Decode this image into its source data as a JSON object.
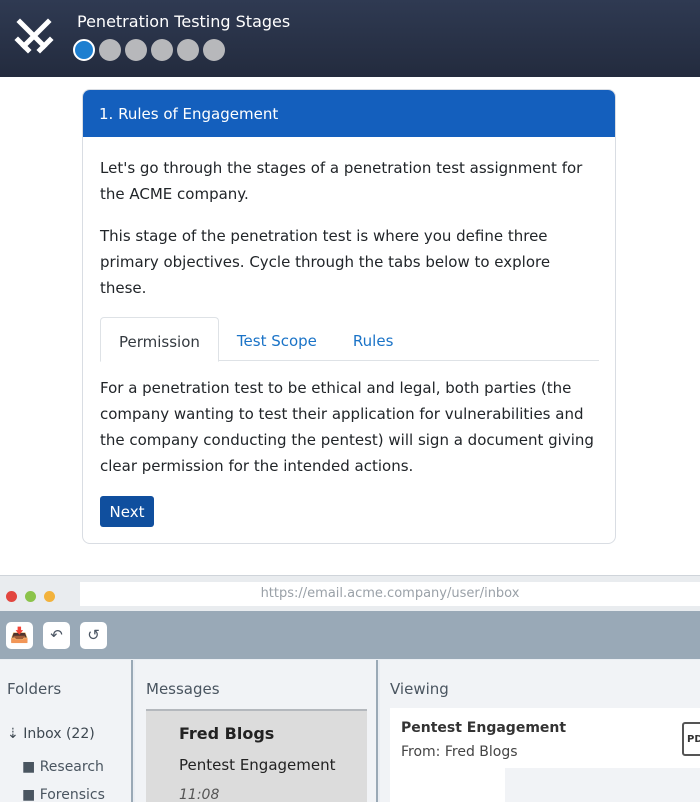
{
  "header": {
    "title": "Penetration Testing Stages",
    "stage_dots": [
      true,
      false,
      false,
      false,
      false,
      false
    ]
  },
  "card": {
    "title": "1. Rules of Engagement",
    "intro": "Let's go through the stages of a penetration test assignment for the ACME company.",
    "description": "This stage of the penetration test is where you define three primary objectives. Cycle through the tabs below to explore these.",
    "tabs": [
      "Permission",
      "Test Scope",
      "Rules"
    ],
    "active_tab": "Permission",
    "tab_content": "For a penetration test to be ethical and legal, both parties (the company wanting to test their application for vulnerabilities and the company conducting the pentest) will sign a document giving clear permission for the intended actions.",
    "next_label": "Next"
  },
  "mail": {
    "url": "https://email.acme.company/user/inbox",
    "folders_title": "Folders",
    "inbox_label": "Inbox (22)",
    "folders": [
      "Research",
      "Forensics"
    ],
    "messages_title": "Messages",
    "message": {
      "sender": "Fred Blogs",
      "subject": "Pentest Engagement",
      "time": "11:08"
    },
    "viewing_title": "Viewing",
    "viewing": {
      "subject": "Pentest Engagement",
      "from": "From: Fred Blogs",
      "attachment_icon": "PDF"
    },
    "colors": {
      "header_bg": "#232b3e",
      "card_header": "#145fbd",
      "toolbar": "#99a9b7"
    }
  }
}
